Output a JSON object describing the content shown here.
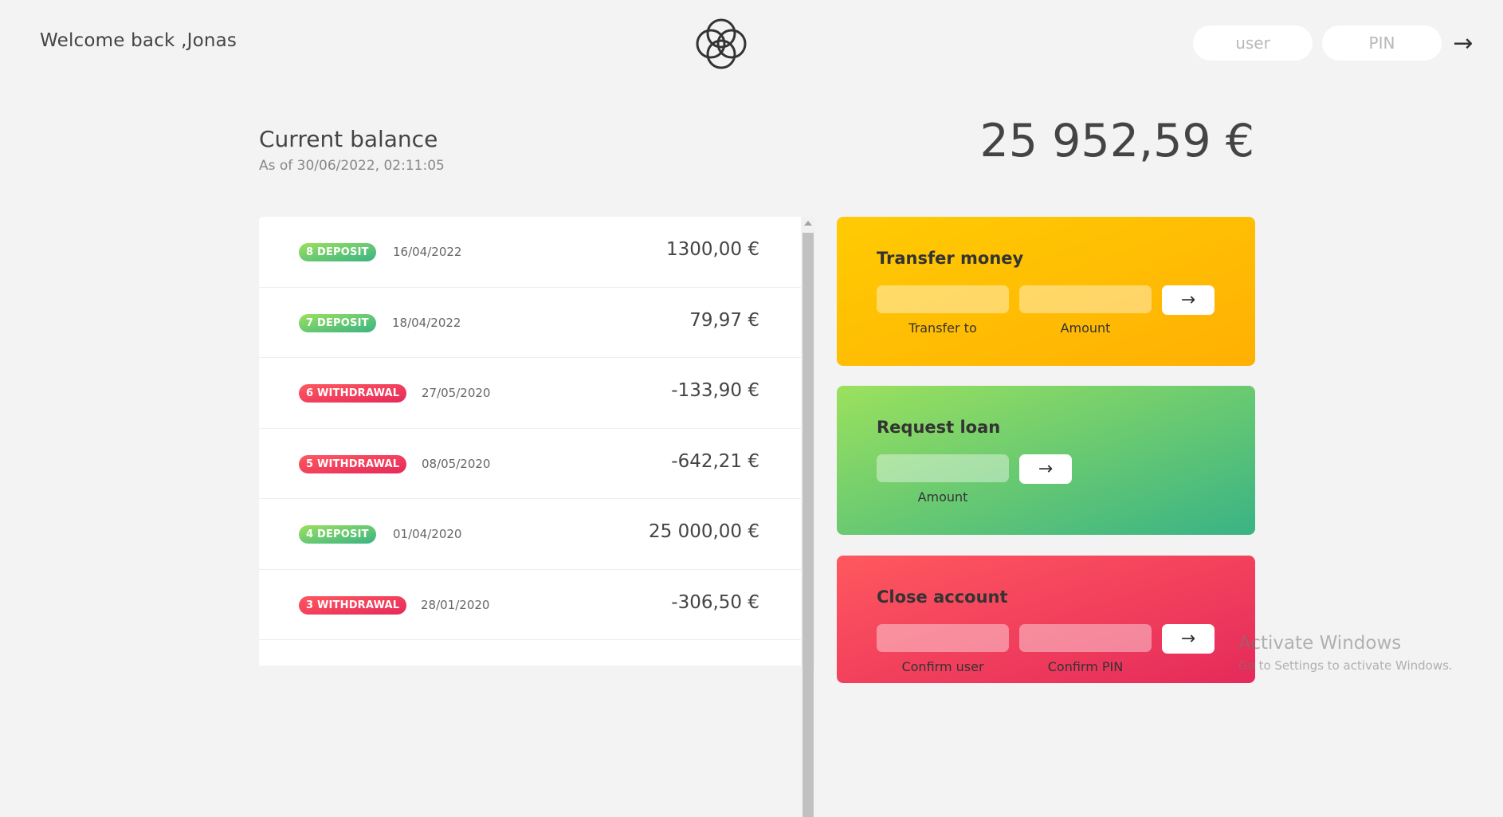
{
  "nav": {
    "welcome": "Welcome back ,Jonas",
    "user_placeholder": "user",
    "pin_placeholder": "PIN",
    "login_btn": "→",
    "logo_icon": "rings-logo-icon"
  },
  "balance": {
    "label": "Current balance",
    "date": "As of 30/06/2022, 02:11:05",
    "value": "25 952,59 €"
  },
  "movements": [
    {
      "type": "8 deposit",
      "kind": "deposit",
      "date": "16/04/2022",
      "value": "1300,00 €"
    },
    {
      "type": "7 deposit",
      "kind": "deposit",
      "date": "18/04/2022",
      "value": "79,97 €"
    },
    {
      "type": "6 withdrawal",
      "kind": "withdrawal",
      "date": "27/05/2020",
      "value": "-133,90 €"
    },
    {
      "type": "5 withdrawal",
      "kind": "withdrawal",
      "date": "08/05/2020",
      "value": "-642,21 €"
    },
    {
      "type": "4 deposit",
      "kind": "deposit",
      "date": "01/04/2020",
      "value": "25 000,00 €"
    },
    {
      "type": "3 withdrawal",
      "kind": "withdrawal",
      "date": "28/01/2020",
      "value": "-306,50 €"
    }
  ],
  "transfer": {
    "title": "Transfer money",
    "btn": "→",
    "label_to": "Transfer to",
    "label_amount": "Amount"
  },
  "loan": {
    "title": "Request loan",
    "btn": "→",
    "label_amount": "Amount"
  },
  "close": {
    "title": "Close account",
    "btn": "→",
    "label_user": "Confirm user",
    "label_pin": "Confirm PIN"
  },
  "watermark": {
    "title": "Activate Windows",
    "sub": "Go to Settings to activate Windows."
  },
  "colors": {
    "deposit_start": "#39b385",
    "deposit_end": "#9be15d",
    "withdrawal_start": "#e52a5a",
    "withdrawal_end": "#ff585f",
    "transfer_start": "#ffb003",
    "transfer_end": "#ffcb03"
  }
}
